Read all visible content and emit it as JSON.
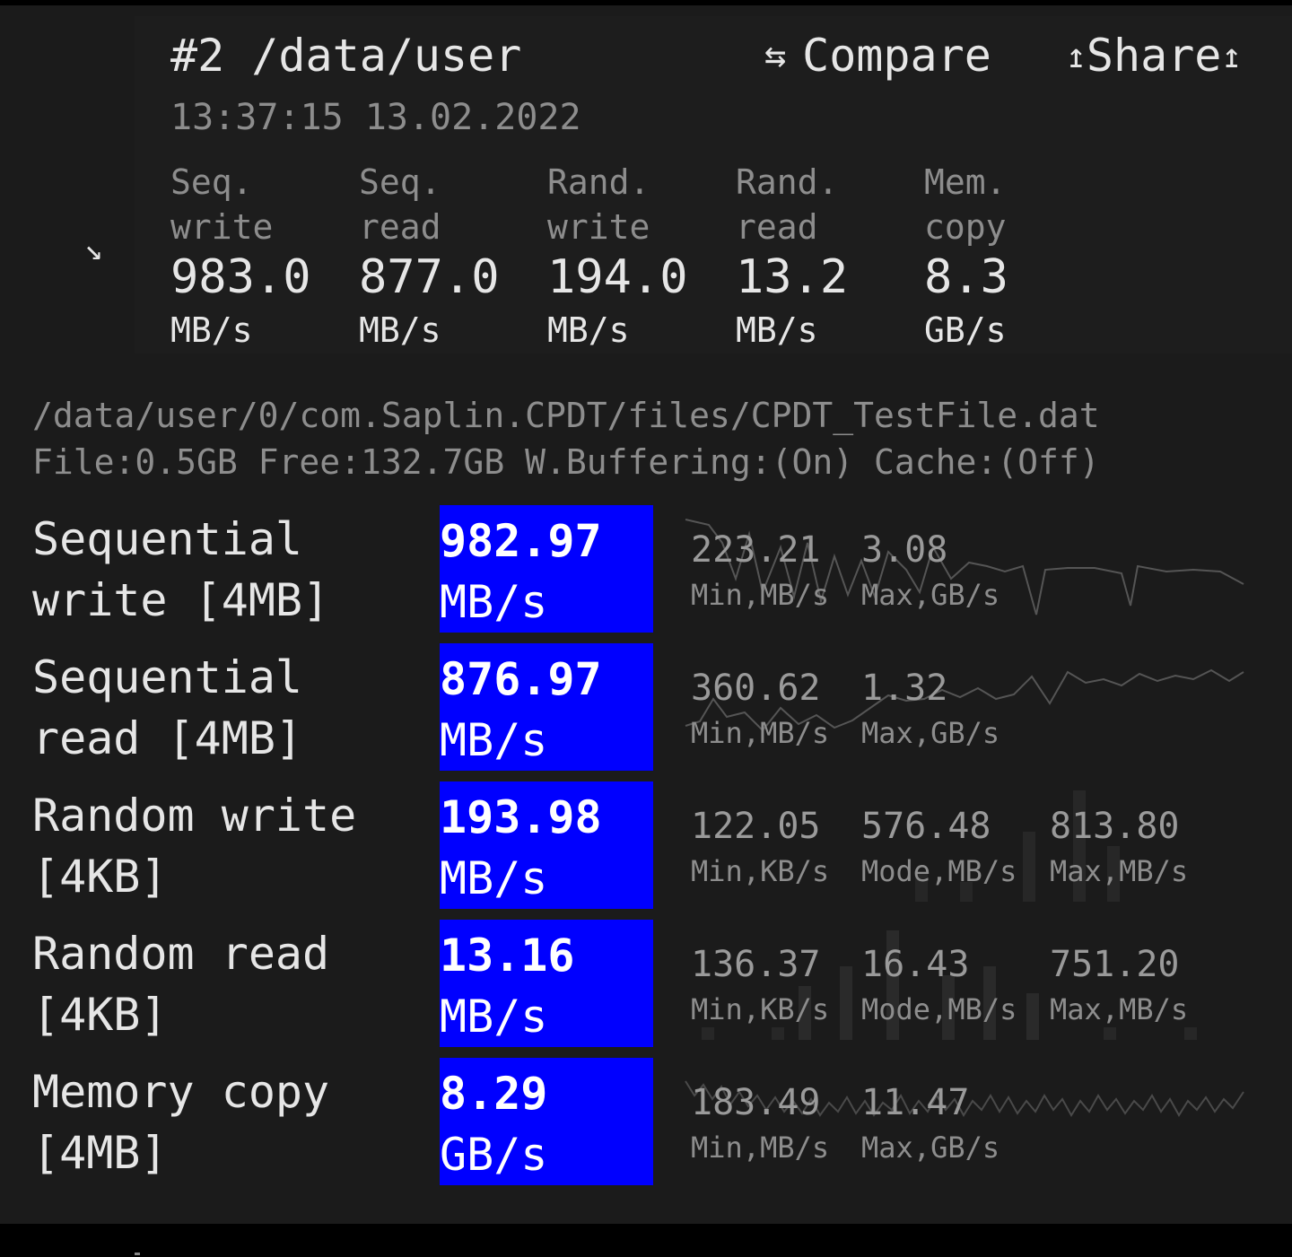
{
  "header": {
    "title": "#2 /data/user",
    "timestamp": "13:37:15 13.02.2022",
    "compare_label": "Compare",
    "share_label": "Share"
  },
  "icons": {
    "expand": "arrow-down-right-icon",
    "compare": "swap-arrows-icon",
    "share": "share-arrow-icon"
  },
  "summary": [
    {
      "label1": "Seq.",
      "label2": "write",
      "value": "983.0",
      "unit": "MB/s"
    },
    {
      "label1": "Seq.",
      "label2": "read",
      "value": "877.0",
      "unit": "MB/s"
    },
    {
      "label1": "Rand.",
      "label2": "write",
      "value": "194.0",
      "unit": "MB/s"
    },
    {
      "label1": "Rand.",
      "label2": "read",
      "value": "13.2",
      "unit": "MB/s"
    },
    {
      "label1": "Mem.",
      "label2": "copy",
      "value": "8.3",
      "unit": "GB/s"
    }
  ],
  "file_info": {
    "path": "/data/user/0/com.Saplin.CPDT/files/CPDT_TestFile.dat",
    "details": "File:0.5GB Free:132.7GB W.Buffering:(On) Cache:(Off)"
  },
  "tests": [
    {
      "name1": "Sequential",
      "name2": "write [4MB]",
      "value": "982.97",
      "unit": "MB/s",
      "stats": [
        {
          "value": "223.21",
          "label": "Min,MB/s"
        },
        {
          "value": "3.08",
          "label": "Max,GB/s"
        }
      ]
    },
    {
      "name1": "Sequential",
      "name2": "read [4MB]",
      "value": "876.97",
      "unit": "MB/s",
      "stats": [
        {
          "value": "360.62",
          "label": "Min,MB/s"
        },
        {
          "value": "1.32",
          "label": "Max,GB/s"
        }
      ]
    },
    {
      "name1": "Random write",
      "name2": "[4KB]",
      "value": "193.98",
      "unit": "MB/s",
      "stats": [
        {
          "value": "122.05",
          "label": "Min,KB/s"
        },
        {
          "value": "576.48",
          "label": "Mode,MB/s"
        },
        {
          "value": "813.80",
          "label": "Max,MB/s"
        }
      ]
    },
    {
      "name1": "Random read",
      "name2": "[4KB]",
      "value": "13.16",
      "unit": "MB/s",
      "stats": [
        {
          "value": "136.37",
          "label": "Min,KB/s"
        },
        {
          "value": "16.43",
          "label": "Mode,MB/s"
        },
        {
          "value": "751.20",
          "label": "Max,MB/s"
        }
      ]
    },
    {
      "name1": "Memory copy",
      "name2": "[4MB]",
      "value": "8.29",
      "unit": "GB/s",
      "stats": [
        {
          "value": "183.49",
          "label": "Min,MB/s"
        },
        {
          "value": "11.47",
          "label": "Max,GB/s"
        }
      ]
    }
  ],
  "colors": {
    "background": "#1b1b1b",
    "value_highlight": "#0000ff",
    "text_primary": "#e6e6e6",
    "text_secondary": "#8d8d8d"
  }
}
